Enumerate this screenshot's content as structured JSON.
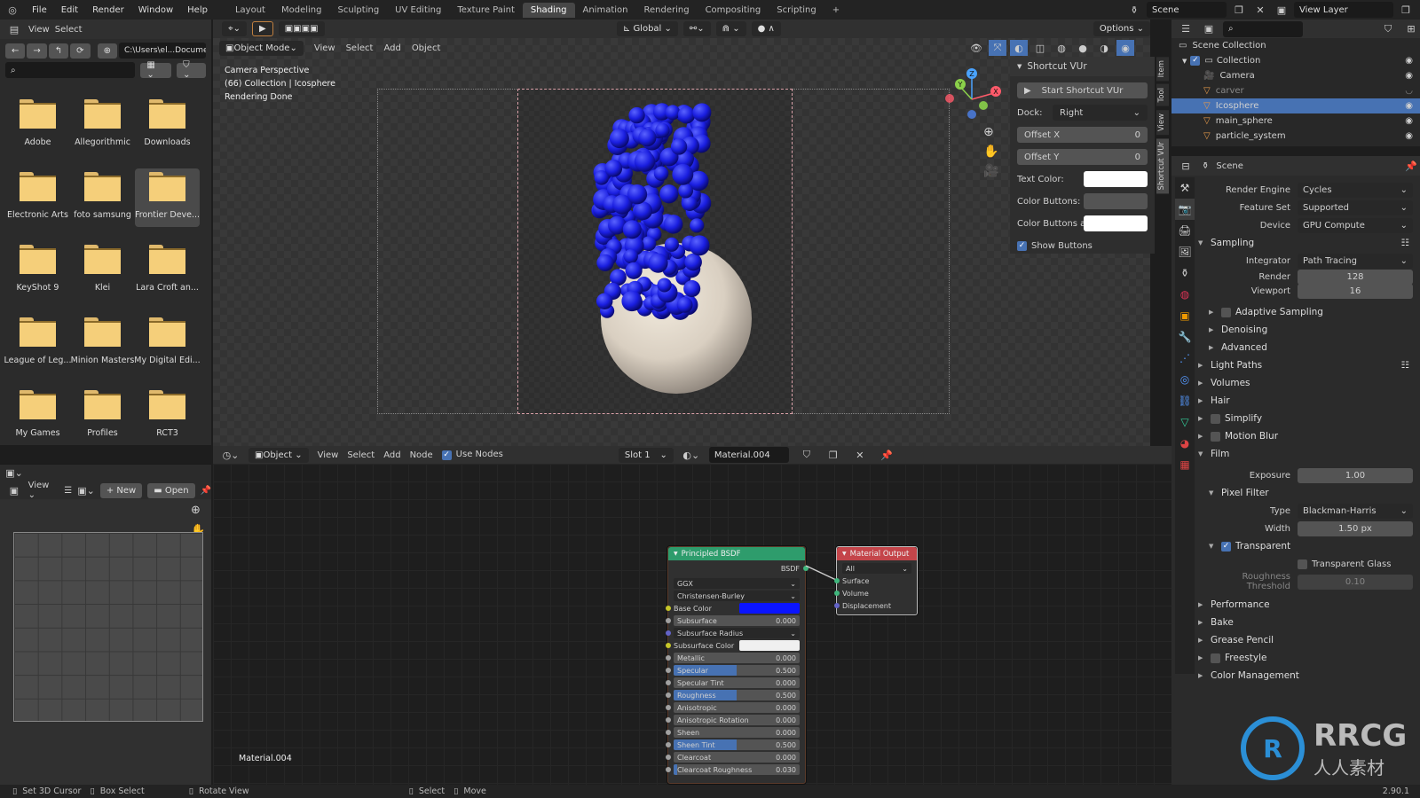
{
  "topbar": {
    "menus": [
      "File",
      "Edit",
      "Render",
      "Window",
      "Help"
    ],
    "workspaces": [
      "Layout",
      "Modeling",
      "Sculpting",
      "UV Editing",
      "Texture Paint",
      "Shading",
      "Animation",
      "Rendering",
      "Compositing",
      "Scripting"
    ],
    "active_workspace": "Shading",
    "scene": "Scene",
    "view_layer": "View Layer"
  },
  "filebrowser": {
    "header": {
      "view": "View",
      "select": "Select"
    },
    "path": "C:\\Users\\el...Documenti\\",
    "search_placeholder": "",
    "folders": [
      "Adobe",
      "Allegorithmic",
      "Downloads",
      "Electronic Arts",
      "foto samsung",
      "Frontier Deve...",
      "KeyShot 9",
      "Klei",
      "Lara Croft an...",
      "League of Leg...",
      "Minion Masters",
      "My Digital Edi...",
      "My Games",
      "Profiles",
      "RCT3"
    ],
    "selected_folder": "Frontier Deve..."
  },
  "viewport": {
    "toolbar": {
      "transform_orientation": "Global",
      "options": "Options"
    },
    "header": {
      "mode": "Object Mode",
      "view": "View",
      "select": "Select",
      "add": "Add",
      "object": "Object"
    },
    "overlay_text": [
      "Camera Perspective",
      "(66) Collection | Icosphere",
      "Rendering Done"
    ],
    "gizmo_axes": [
      "X",
      "Y",
      "Z"
    ],
    "side_tabs": [
      "Item",
      "Tool",
      "View",
      "Shortcut VUr"
    ]
  },
  "shortcut_panel": {
    "title": "Shortcut VUr",
    "start_button": "Start Shortcut VUr",
    "dock_label": "Dock:",
    "dock_value": "Right",
    "offset_x_label": "Offset X",
    "offset_x_value": "0",
    "offset_y_label": "Offset Y",
    "offset_y_value": "0",
    "text_color_label": "Text Color:",
    "text_color": "#ffffff",
    "color_buttons_label": "Color Buttons:",
    "color_buttons": "#545454",
    "color_buttons_active_label": "Color Buttons ac...",
    "color_buttons_active": "#ffffff",
    "show_buttons_label": "Show Buttons",
    "show_buttons": true
  },
  "outliner": {
    "root": "Scene Collection",
    "collection": "Collection",
    "items": [
      {
        "name": "Camera",
        "selected": false,
        "dim": false
      },
      {
        "name": "carver",
        "selected": false,
        "dim": true
      },
      {
        "name": "Icosphere",
        "selected": true,
        "dim": false
      },
      {
        "name": "main_sphere",
        "selected": false,
        "dim": false
      },
      {
        "name": "particle_system",
        "selected": false,
        "dim": false
      }
    ]
  },
  "properties": {
    "context": "Scene",
    "render_engine_label": "Render Engine",
    "render_engine": "Cycles",
    "feature_set_label": "Feature Set",
    "feature_set": "Supported",
    "device_label": "Device",
    "device": "GPU Compute",
    "sampling": "Sampling",
    "integrator_label": "Integrator",
    "integrator": "Path Tracing",
    "render_label": "Render",
    "render_samples": "128",
    "viewport_label": "Viewport",
    "viewport_samples": "16",
    "adaptive_sampling": "Adaptive Sampling",
    "denoising": "Denoising",
    "advanced": "Advanced",
    "light_paths": "Light Paths",
    "volumes": "Volumes",
    "hair": "Hair",
    "simplify": "Simplify",
    "motion_blur": "Motion Blur",
    "film": "Film",
    "exposure_label": "Exposure",
    "exposure": "1.00",
    "pixel_filter": "Pixel Filter",
    "type_label": "Type",
    "type": "Blackman-Harris",
    "width_label": "Width",
    "width": "1.50 px",
    "transparent": "Transparent",
    "transparent_glass": "Transparent Glass",
    "roughness_threshold_label": "Roughness Threshold",
    "roughness_threshold": "0.10",
    "performance": "Performance",
    "bake": "Bake",
    "grease_pencil": "Grease Pencil",
    "freestyle": "Freestyle",
    "color_management": "Color Management"
  },
  "image_editor": {
    "view": "View",
    "new": "New",
    "open": "Open"
  },
  "node_editor": {
    "header": {
      "object": "Object",
      "view": "View",
      "select": "Select",
      "add": "Add",
      "node": "Node",
      "use_nodes": "Use Nodes",
      "slot": "Slot 1",
      "material": "Material.004"
    },
    "material_label": "Material.004",
    "bsdf_node": {
      "title": "Principled BSDF",
      "output": "BSDF",
      "distribution": "GGX",
      "subsurface_method": "Christensen-Burley",
      "base_color_label": "Base Color",
      "base_color": "#0a14ff",
      "subsurface_color_label": "Subsurface Color",
      "subsurface_color": "#f0f0f0",
      "subsurface_radius": "Subsurface Radius",
      "fields": [
        {
          "label": "Subsurface",
          "value": "0.000",
          "fill": 0
        },
        {
          "label": "Metallic",
          "value": "0.000",
          "fill": 0
        },
        {
          "label": "Specular",
          "value": "0.500",
          "fill": 0.5
        },
        {
          "label": "Specular Tint",
          "value": "0.000",
          "fill": 0
        },
        {
          "label": "Roughness",
          "value": "0.500",
          "fill": 0.5
        },
        {
          "label": "Anisotropic",
          "value": "0.000",
          "fill": 0
        },
        {
          "label": "Anisotropic Rotation",
          "value": "0.000",
          "fill": 0
        },
        {
          "label": "Sheen",
          "value": "0.000",
          "fill": 0
        },
        {
          "label": "Sheen Tint",
          "value": "0.500",
          "fill": 0.5
        },
        {
          "label": "Clearcoat",
          "value": "0.000",
          "fill": 0
        },
        {
          "label": "Clearcoat Roughness",
          "value": "0.030",
          "fill": 0.03
        }
      ]
    },
    "output_node": {
      "title": "Material Output",
      "target": "All",
      "inputs": [
        "Surface",
        "Volume",
        "Displacement"
      ]
    }
  },
  "statusbar": {
    "items": [
      "Set 3D Cursor",
      "Box Select",
      "Rotate View",
      "Select",
      "Move"
    ],
    "version": "2.90.1"
  },
  "watermark": {
    "brand": "RRCG",
    "sub": "人人素材"
  }
}
